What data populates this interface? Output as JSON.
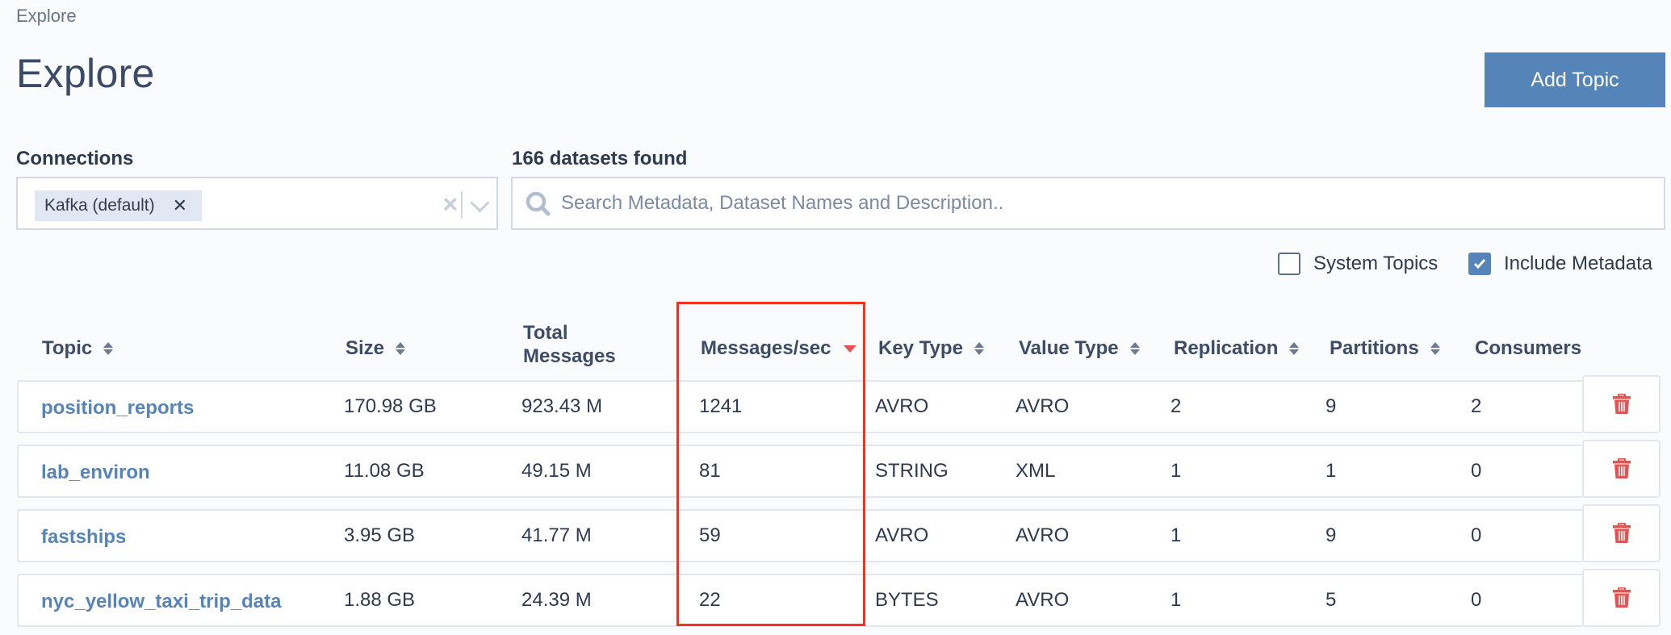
{
  "breadcrumb": "Explore",
  "page_title": "Explore",
  "add_topic_button": "Add Topic",
  "connections": {
    "label": "Connections",
    "selected": [
      {
        "label": "Kafka (default)",
        "remove_icon": "close-icon"
      }
    ],
    "clear_icon": "close-icon",
    "dropdown_icon": "chevron-down-icon"
  },
  "search": {
    "results_label": "166 datasets found",
    "placeholder": "Search Metadata, Dataset Names and Description..",
    "value": "",
    "icon": "search-icon"
  },
  "filters": {
    "system_topics": {
      "label": "System Topics",
      "checked": false
    },
    "include_metadata": {
      "label": "Include Metadata",
      "checked": true
    }
  },
  "table": {
    "columns": [
      {
        "key": "topic",
        "label": "Topic",
        "sortable": true,
        "sort": "none"
      },
      {
        "key": "size",
        "label": "Size",
        "sortable": true,
        "sort": "none"
      },
      {
        "key": "total_messages",
        "label": "Total Messages",
        "sortable": false,
        "sort": "none"
      },
      {
        "key": "messages_per_sec",
        "label": "Messages/sec",
        "sortable": true,
        "sort": "desc"
      },
      {
        "key": "key_type",
        "label": "Key Type",
        "sortable": true,
        "sort": "none"
      },
      {
        "key": "value_type",
        "label": "Value Type",
        "sortable": true,
        "sort": "none"
      },
      {
        "key": "replication",
        "label": "Replication",
        "sortable": true,
        "sort": "none"
      },
      {
        "key": "partitions",
        "label": "Partitions",
        "sortable": true,
        "sort": "none"
      },
      {
        "key": "consumers",
        "label": "Consumers",
        "sortable": false,
        "sort": "none"
      }
    ],
    "rows": [
      {
        "topic": "position_reports",
        "size": "170.98 GB",
        "total_messages": "923.43 M",
        "messages_per_sec": "1241",
        "key_type": "AVRO",
        "value_type": "AVRO",
        "replication": "2",
        "partitions": "9",
        "consumers": "2"
      },
      {
        "topic": "lab_environ",
        "size": "11.08 GB",
        "total_messages": "49.15 M",
        "messages_per_sec": "81",
        "key_type": "STRING",
        "value_type": "XML",
        "replication": "1",
        "partitions": "1",
        "consumers": "0"
      },
      {
        "topic": "fastships",
        "size": "3.95 GB",
        "total_messages": "41.77 M",
        "messages_per_sec": "59",
        "key_type": "AVRO",
        "value_type": "AVRO",
        "replication": "1",
        "partitions": "9",
        "consumers": "0"
      },
      {
        "topic": "nyc_yellow_taxi_trip_data",
        "size": "1.88 GB",
        "total_messages": "24.39 M",
        "messages_per_sec": "22",
        "key_type": "BYTES",
        "value_type": "AVRO",
        "replication": "1",
        "partitions": "5",
        "consumers": "0"
      }
    ],
    "row_action_icon": "trash-icon"
  },
  "colors": {
    "accent": "#5584b9",
    "danger": "#e55252",
    "highlight_border": "#f2311f",
    "background": "#f9fbfd"
  }
}
